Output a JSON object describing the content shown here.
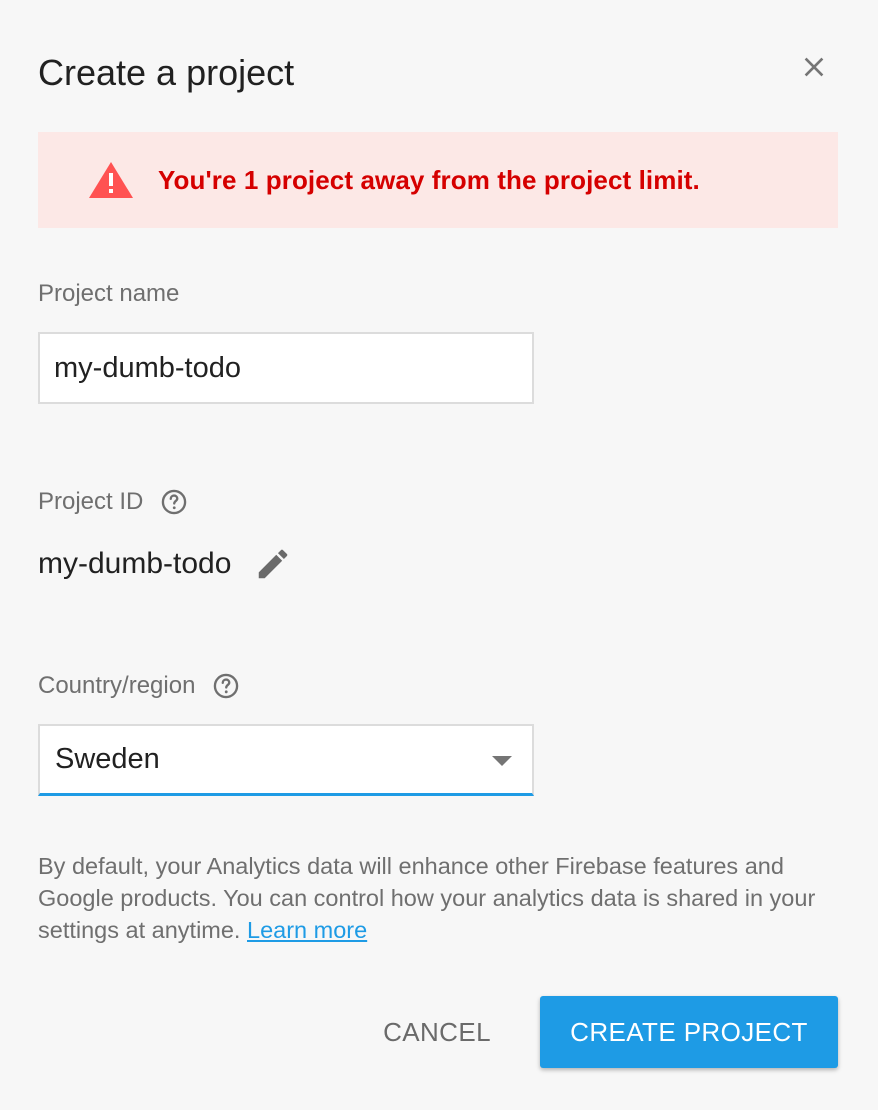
{
  "dialog": {
    "title": "Create a project",
    "close_icon": "close-icon"
  },
  "warning": {
    "icon": "warning-triangle-icon",
    "text": "You're 1 project away from the project limit.",
    "color": "#d50000",
    "background": "#fce8e6"
  },
  "project_name": {
    "label": "Project name",
    "value": "my-dumb-todo"
  },
  "project_id": {
    "label": "Project ID",
    "help_icon": "help-circle-icon",
    "value": "my-dumb-todo",
    "edit_icon": "pencil-icon"
  },
  "country": {
    "label": "Country/region",
    "help_icon": "help-circle-icon",
    "selected": "Sweden"
  },
  "info": {
    "text": "By default, your Analytics data will enhance other Firebase features and Google products. You can control how your analytics data is shared in your settings at anytime.",
    "link": "Learn more"
  },
  "actions": {
    "cancel_label": "CANCEL",
    "create_label": "CREATE PROJECT",
    "accent": "#1e9be5"
  }
}
